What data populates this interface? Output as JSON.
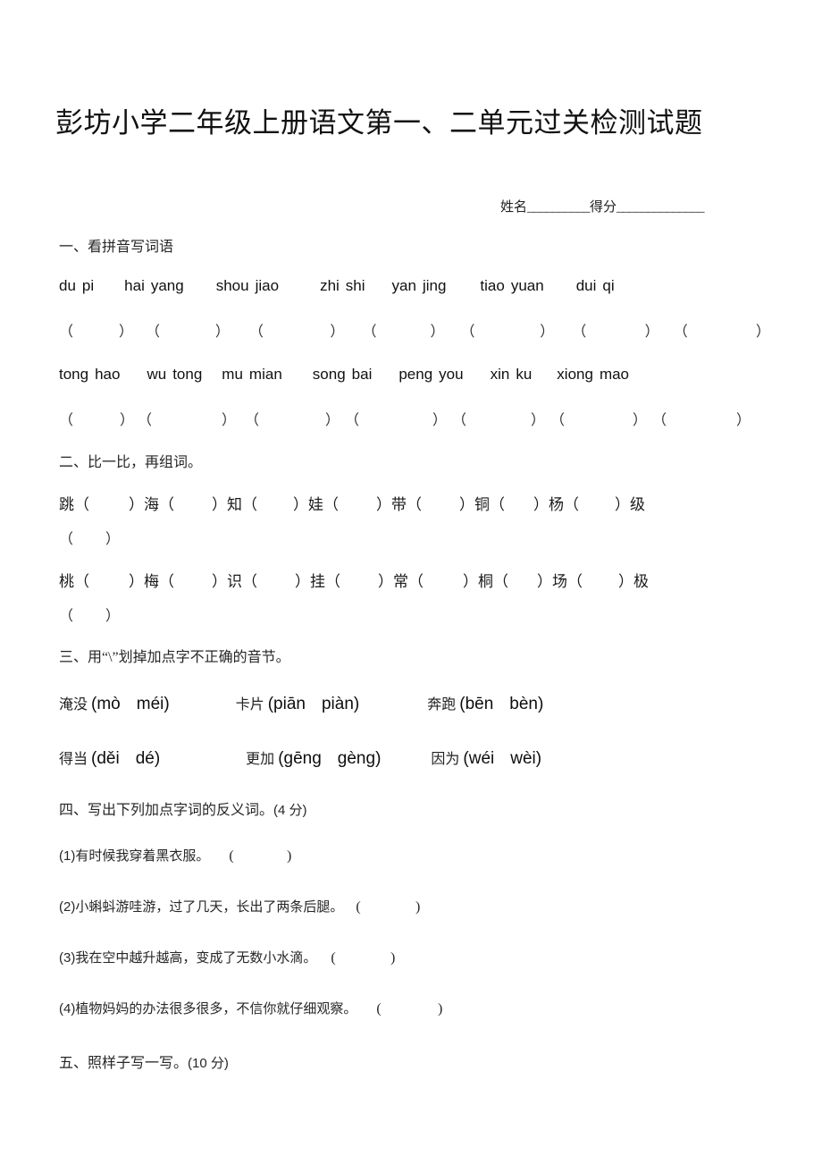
{
  "document": {
    "title": "彭坊小学二年级上册语文第一、二单元过关检测试题",
    "name_label": "姓名",
    "name_rule": "__________",
    "score_label": "得分",
    "score_rule": "______________"
  },
  "sections": {
    "s1": {
      "heading": "一、看拼音写词语",
      "rows": [
        {
          "words": [
            {
              "syllables": [
                "du",
                "pi"
              ]
            },
            {
              "syllables": [
                "hai",
                "yang"
              ]
            },
            {
              "syllables": [
                "shou",
                "jiao"
              ]
            },
            {
              "syllables": [
                "zhi",
                "shi"
              ]
            },
            {
              "syllables": [
                "yan",
                "jing"
              ]
            },
            {
              "syllables": [
                "tiao",
                "yuan"
              ]
            },
            {
              "syllables": [
                "dui",
                "qi"
              ]
            }
          ],
          "blank_count": 7
        },
        {
          "words": [
            {
              "syllables": [
                "tong",
                "hao"
              ]
            },
            {
              "syllables": [
                "wu",
                "tong"
              ]
            },
            {
              "syllables": [
                "mu",
                "mian"
              ]
            },
            {
              "syllables": [
                "song",
                "bai"
              ]
            },
            {
              "syllables": [
                "peng",
                "you"
              ]
            },
            {
              "syllables": [
                "xin",
                "ku"
              ]
            },
            {
              "syllables": [
                "xiong",
                "mao"
              ]
            }
          ],
          "blank_count": 7
        }
      ],
      "bracket_open": "（",
      "bracket_close": "）"
    },
    "s2": {
      "heading": "二、比一比，再组词。",
      "rows": [
        {
          "chars": [
            "跳",
            "海",
            "知",
            "娃",
            "带",
            "铜",
            "杨"
          ],
          "tail_char": "级"
        },
        {
          "chars": [
            "桃",
            "梅",
            "识",
            "挂",
            "常",
            "桐",
            "场"
          ],
          "tail_char": "极"
        }
      ],
      "bracket_open": "（",
      "bracket_close": "）"
    },
    "s3": {
      "heading": "三、用“\\”划掉加点字不正确的音节。",
      "rows": [
        [
          {
            "word": "淹没",
            "options": [
              "mò",
              "méi"
            ]
          },
          {
            "word": "卡片",
            "options": [
              "piān",
              "piàn"
            ]
          },
          {
            "word": "奔跑",
            "options": [
              "bēn",
              "bèn"
            ]
          }
        ],
        [
          {
            "word": "得当",
            "options": [
              "děi",
              "dé"
            ]
          },
          {
            "word": "更加",
            "options": [
              "gēng",
              "gèng"
            ]
          },
          {
            "word": "因为",
            "options": [
              "wéi",
              "wèi"
            ]
          }
        ]
      ],
      "paren_open": "(",
      "paren_close": ")"
    },
    "s4": {
      "heading": "四、写出下列加点字词的反义词。",
      "points": "(4 分)",
      "items": [
        {
          "num": "(1)",
          "text": "有时候我穿着黑衣服。"
        },
        {
          "num": "(2)",
          "text": "小蝌蚪游哇游，过了几天，长出了两条后腿。"
        },
        {
          "num": "(3)",
          "text": "我在空中越升越高，变成了无数小水滴。"
        },
        {
          "num": "(4)",
          "text": "植物妈妈的办法很多很多，不信你就仔细观察。"
        }
      ],
      "bracket_open": "(",
      "bracket_close": ")"
    },
    "s5": {
      "heading": "五、照样子写一写。",
      "points": "(10 分)"
    }
  }
}
